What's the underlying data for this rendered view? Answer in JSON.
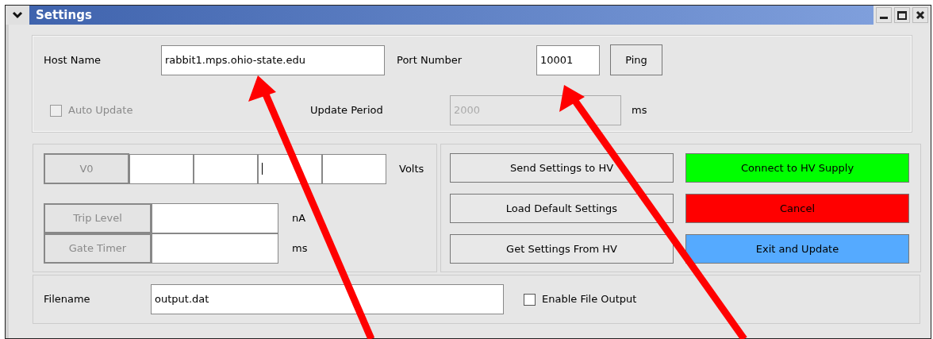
{
  "window": {
    "title": "Settings"
  },
  "connection": {
    "host_label": "Host Name",
    "host": "rabbit1.mps.ohio-state.edu",
    "port_label": "Port Number",
    "port": "10001",
    "ping": "Ping"
  },
  "auto_update": {
    "label": "Auto Update",
    "checked": false,
    "disabled": true
  },
  "update_period": {
    "label": "Update Period",
    "value": "2000",
    "disabled": true,
    "unit": "ms"
  },
  "voltages": {
    "button": "V0",
    "disabled": true,
    "unit": "Volts",
    "fields": [
      {
        "focused": false
      },
      {
        "focused": false
      },
      {
        "focused": true
      },
      {
        "focused": false
      }
    ]
  },
  "limits": [
    {
      "label": "Trip Level",
      "unit": "nA",
      "disabled": true
    },
    {
      "label": "Gate Timer",
      "unit": "ms",
      "disabled": true
    }
  ],
  "actions": [
    "Send Settings to HV",
    "Load Default Settings",
    "Get Settings From HV"
  ],
  "main_actions": [
    {
      "label": "Connect to HV Supply",
      "color": "#00ff00"
    },
    {
      "label": "Cancel",
      "color": "#ff0000"
    },
    {
      "label": "Exit and Update",
      "color": "#55aaff"
    }
  ],
  "file": {
    "label": "Filename",
    "value": "output.dat",
    "enable": {
      "label": "Enable File Output",
      "checked": false
    }
  }
}
